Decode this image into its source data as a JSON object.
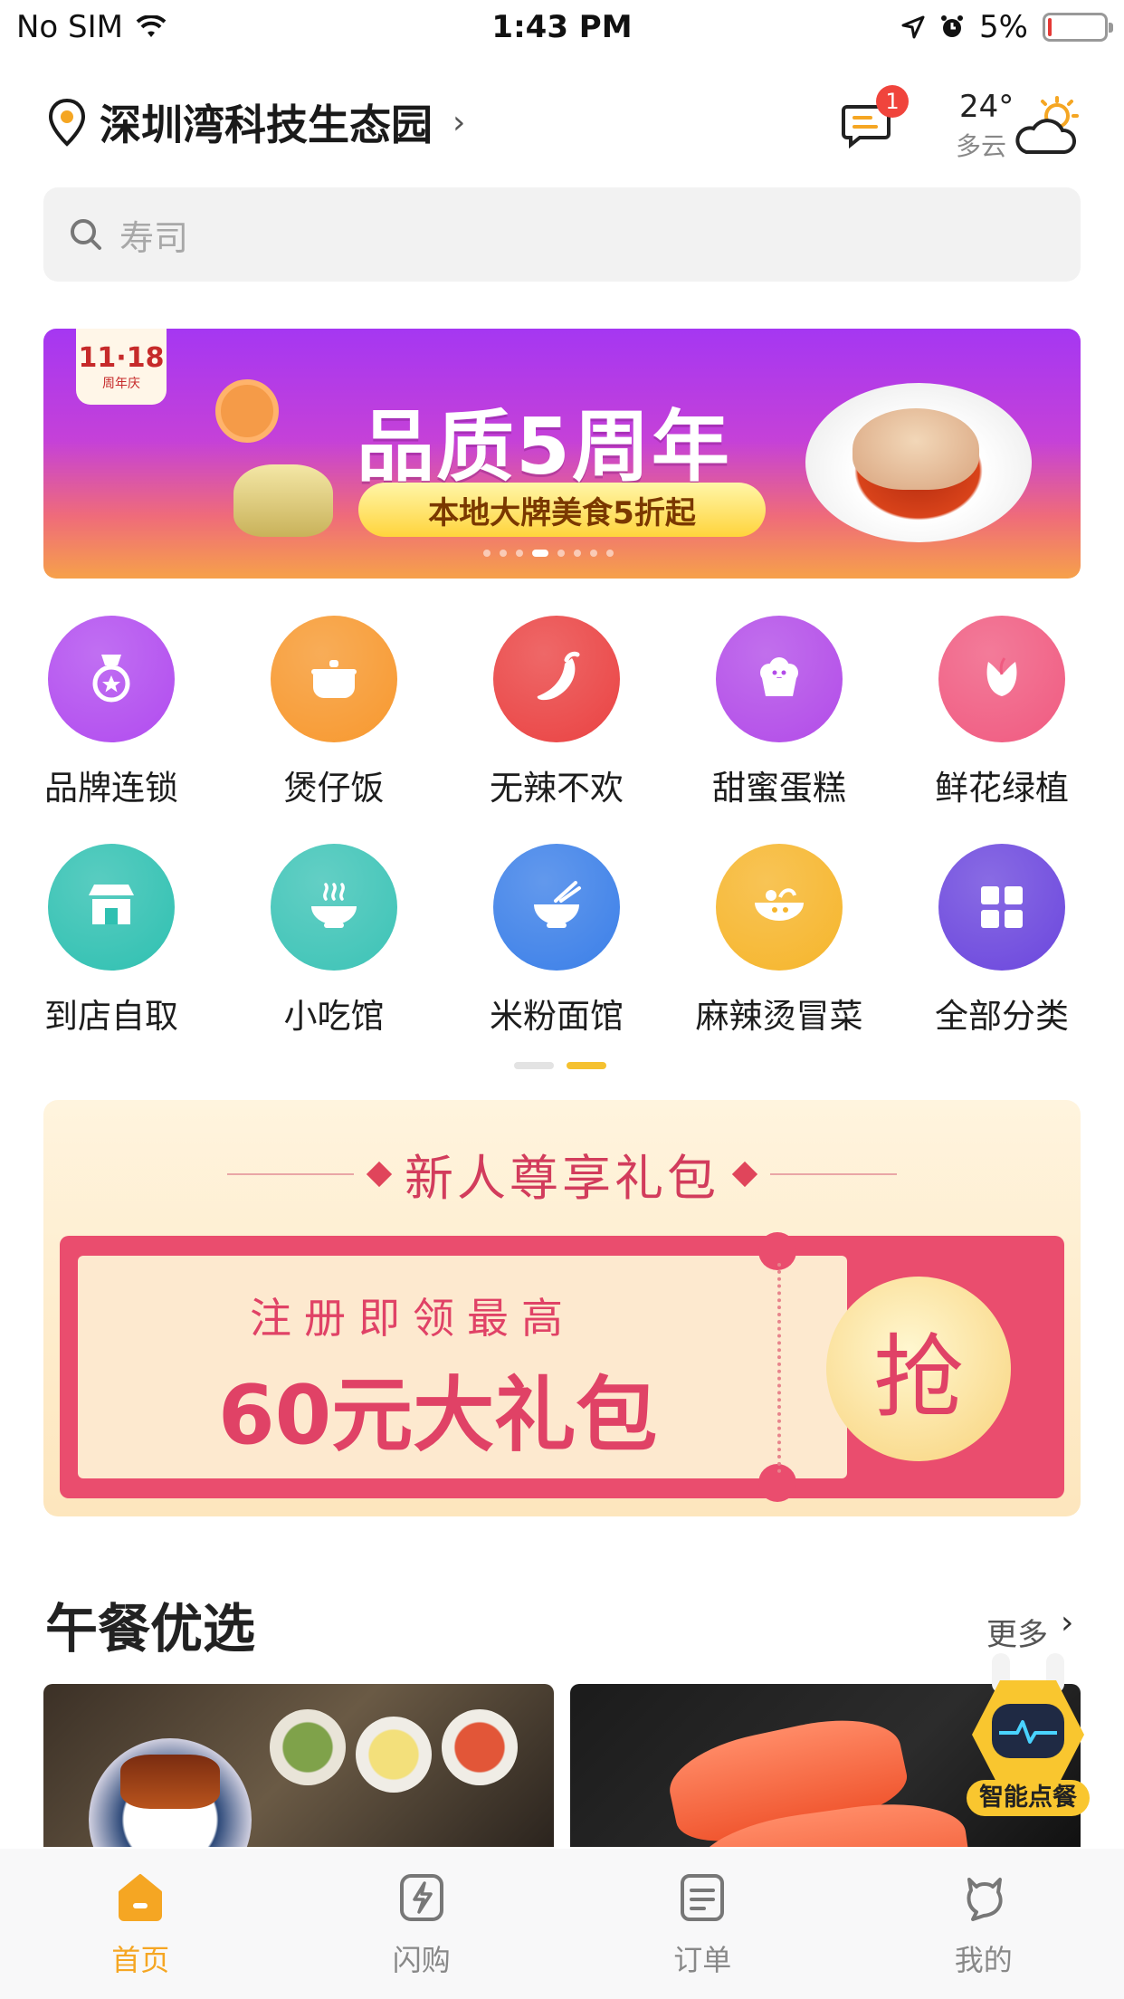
{
  "status_bar": {
    "carrier": "No SIM",
    "time": "1:43 PM",
    "battery": "5%",
    "battery_level": 0.05
  },
  "header": {
    "location": "深圳湾科技生态园",
    "message_badge": "1",
    "weather": {
      "temp": "24°",
      "desc": "多云"
    }
  },
  "search": {
    "placeholder": "寿司"
  },
  "banner": {
    "logo_big": "11·18",
    "logo_small": "周年庆",
    "title": "品质5周年",
    "subtitle": "本地大牌美食5折起",
    "dot_count": 8,
    "active_dot": 3
  },
  "categories": [
    {
      "label": "品牌连锁",
      "icon": "medal-icon",
      "color": "#b14bef"
    },
    {
      "label": "煲仔饭",
      "icon": "pot-icon",
      "color": "#f7982e"
    },
    {
      "label": "无辣不欢",
      "icon": "chili-icon",
      "color": "#ea4242"
    },
    {
      "label": "甜蜜蛋糕",
      "icon": "cake-icon",
      "color": "#b24be8"
    },
    {
      "label": "鲜花绿植",
      "icon": "flower-icon",
      "color": "#f05a80"
    },
    {
      "label": "到店自取",
      "icon": "store-icon",
      "color": "#2fc0b1"
    },
    {
      "label": "小吃馆",
      "icon": "steaming-bowl-icon",
      "color": "#3cc3b6"
    },
    {
      "label": "米粉面馆",
      "icon": "noodle-bowl-icon",
      "color": "#3b7fe8"
    },
    {
      "label": "麻辣烫冒菜",
      "icon": "hotpot-icon",
      "color": "#f6b52b"
    },
    {
      "label": "全部分类",
      "icon": "grid-icon",
      "color": "#6b46dd"
    }
  ],
  "category_pager": {
    "pages": 2,
    "active": 1
  },
  "promo": {
    "title": "新人尊享礼包",
    "coupon_sub": "注册即领最高",
    "coupon_main": "60元大礼包",
    "grab": "抢"
  },
  "lunch": {
    "title": "午餐优选",
    "more": "更多"
  },
  "robot": {
    "label": "智能点餐"
  },
  "tabs": [
    {
      "label": "首页",
      "icon": "home-icon",
      "active": true
    },
    {
      "label": "闪购",
      "icon": "flash-icon",
      "active": false
    },
    {
      "label": "订单",
      "icon": "order-icon",
      "active": false
    },
    {
      "label": "我的",
      "icon": "profile-icon",
      "active": false
    }
  ],
  "colors": {
    "accent": "#f5a623",
    "promo_pink": "#e04266",
    "badge_red": "#f0443c"
  }
}
